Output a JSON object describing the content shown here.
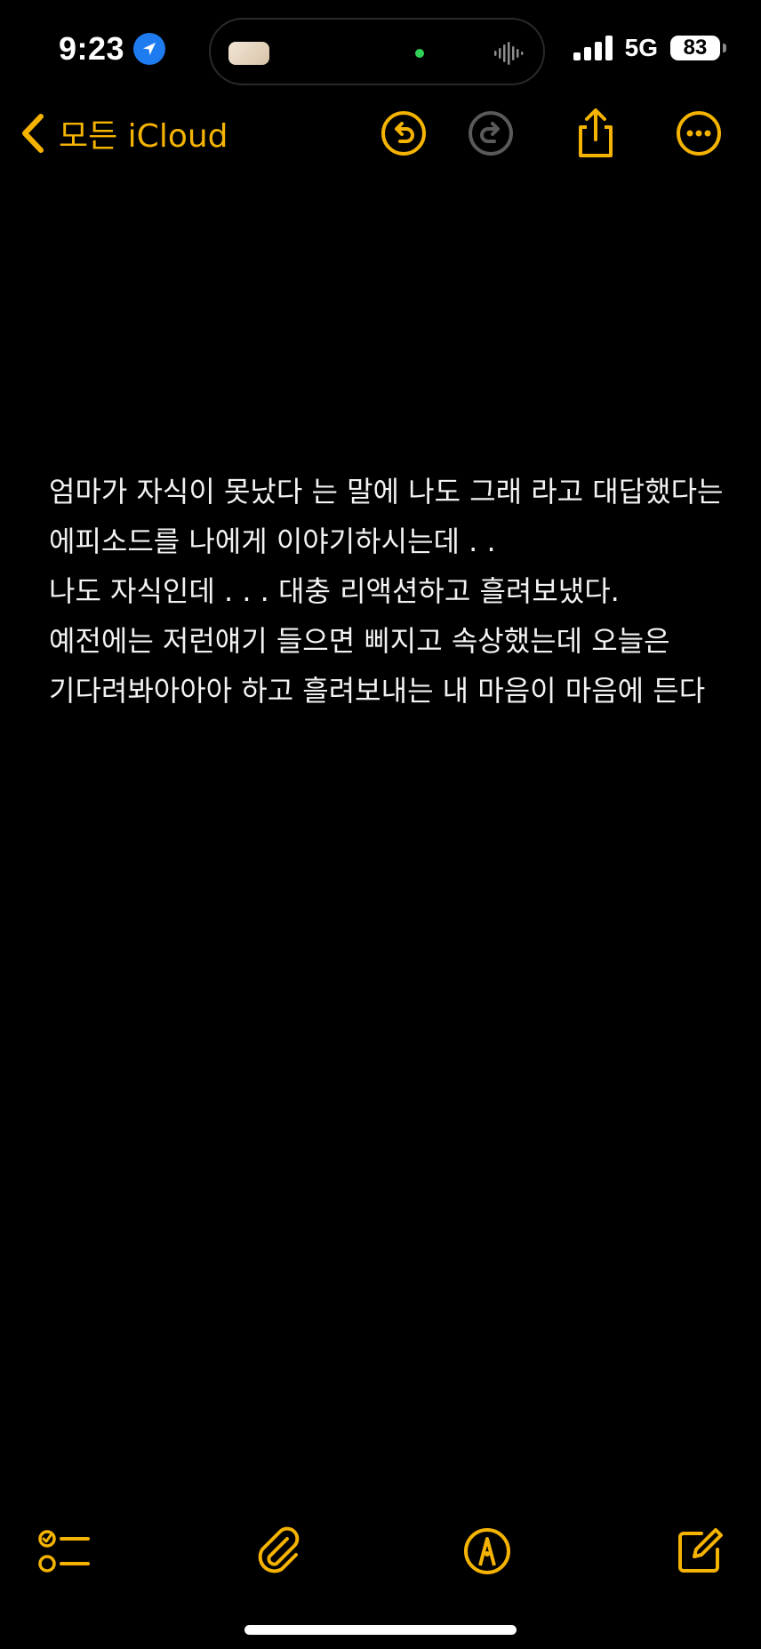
{
  "status_bar": {
    "time": "9:23",
    "network": "5G",
    "battery_level": "83"
  },
  "nav": {
    "back_label": "모든 iCloud",
    "icons": [
      "undo-icon",
      "redo-icon",
      "share-icon",
      "more-icon"
    ]
  },
  "note": {
    "lines": [
      "엄마가 자식이 못났다 는 말에 나도 그래 라고 대답했다는 에피소드를 나에게 이야기하시는데 . .",
      "나도 자식인데 . . .  대충 리액션하고 흘려보냈다. 예전에는 저런얘기 들으면 삐지고 속상했는데 오늘은 기다려봐아아아 하고 흘려보내는 내 마음이 마음에 든다"
    ]
  },
  "toolbar": {
    "icons": [
      "checklist-icon",
      "attachment-icon",
      "markup-icon",
      "compose-icon"
    ]
  },
  "colors": {
    "accent": "#f5b301",
    "background": "#000000",
    "text": "#f2f2f2",
    "disabled": "#5a5a5a",
    "location": "#1f7cf0"
  }
}
